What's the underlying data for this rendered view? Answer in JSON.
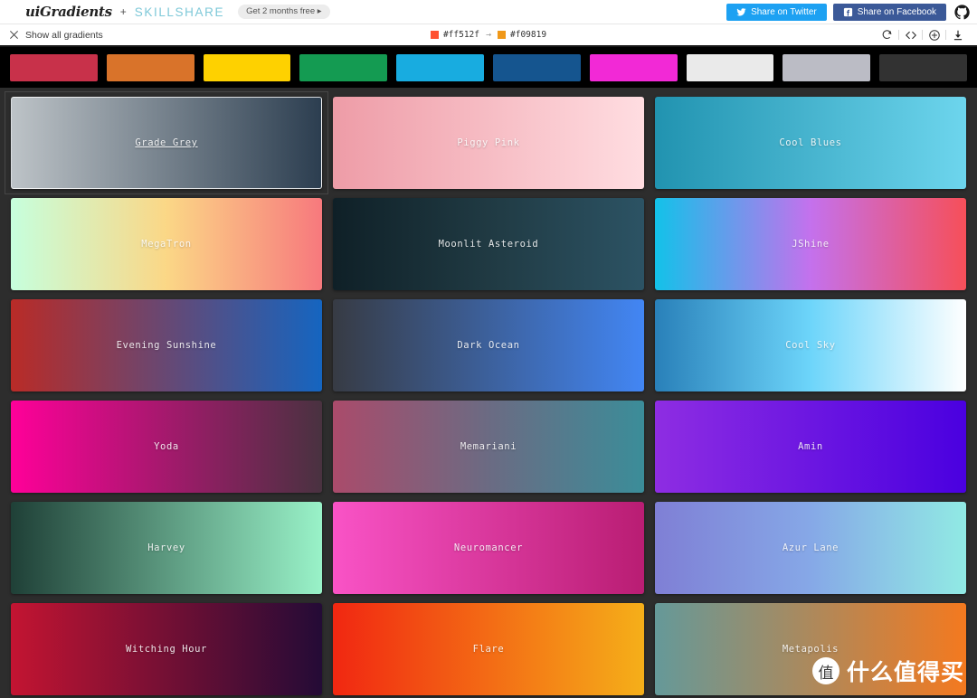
{
  "header": {
    "brand": "uiGradients",
    "plus": "+",
    "partner": "SKILLSHARE",
    "promo": "Get 2 months free ▸",
    "share_twitter": "Share on Twitter",
    "share_facebook": "Share on Facebook",
    "github_icon": "github-icon",
    "twitter_icon": "twitter-icon",
    "facebook_icon": "facebook-icon"
  },
  "subbar": {
    "show_all_label": "Show all gradients",
    "close_icon": "close-icon",
    "gradient_stops": [
      {
        "hex": "#ff512f"
      },
      {
        "hex": "#f09819"
      }
    ],
    "arrow": "→",
    "tools": [
      {
        "name": "refresh-icon",
        "title": "Random gradient"
      },
      {
        "name": "code-icon",
        "title": "Get CSS code"
      },
      {
        "name": "plus-circle-icon",
        "title": "Add gradient"
      },
      {
        "name": "download-icon",
        "title": "Download"
      }
    ]
  },
  "swatches": [
    {
      "name": "red",
      "hex": "#c8314a"
    },
    {
      "name": "orange",
      "hex": "#d9732a"
    },
    {
      "name": "yellow",
      "hex": "#fed100"
    },
    {
      "name": "green",
      "hex": "#149b52"
    },
    {
      "name": "cyan",
      "hex": "#18ace0"
    },
    {
      "name": "blue",
      "hex": "#15558f"
    },
    {
      "name": "magenta",
      "hex": "#f229d6"
    },
    {
      "name": "white",
      "hex": "#eaeaea"
    },
    {
      "name": "grey",
      "hex": "#bbbcc5"
    },
    {
      "name": "black",
      "hex": "#323232"
    }
  ],
  "gradients": [
    {
      "name": "Grade Grey",
      "from": "#bdc3c7",
      "to": "#2c3e50",
      "featured": true,
      "label_underline": true
    },
    {
      "name": "Piggy Pink",
      "from": "#ee9ca7",
      "to": "#ffdde1",
      "featured": false,
      "label_underline": false
    },
    {
      "name": "Cool Blues",
      "from": "#2193b0",
      "to": "#6dd5ed",
      "featured": false,
      "label_underline": false
    },
    {
      "name": "MegaTron",
      "from": "#c6ffdd",
      "mid": "#fbd786",
      "to": "#f7797d",
      "featured": false,
      "label_underline": false
    },
    {
      "name": "Moonlit Asteroid",
      "from": "#0f2027",
      "mid": "#203a43",
      "to": "#2c5364",
      "featured": false,
      "label_underline": false
    },
    {
      "name": "JShine",
      "from": "#12c2e9",
      "mid": "#c471ed",
      "to": "#f64f59",
      "featured": false,
      "label_underline": false
    },
    {
      "name": "Evening Sunshine",
      "from": "#b92b27",
      "to": "#1565c0",
      "featured": false,
      "label_underline": false
    },
    {
      "name": "Dark Ocean",
      "from": "#373b44",
      "to": "#4286f4",
      "featured": false,
      "label_underline": false
    },
    {
      "name": "Cool Sky",
      "from": "#2980b9",
      "mid": "#6dd5fa",
      "to": "#ffffff",
      "featured": false,
      "label_underline": false
    },
    {
      "name": "Yoda",
      "from": "#ff0099",
      "to": "#493240",
      "featured": false,
      "label_underline": false
    },
    {
      "name": "Memariani",
      "from": "#aa4b6b",
      "mid": "#6b6b83",
      "to": "#3b8d99",
      "featured": false,
      "label_underline": false
    },
    {
      "name": "Amin",
      "from": "#8e2de2",
      "to": "#4a00e0",
      "featured": false,
      "label_underline": false
    },
    {
      "name": "Harvey",
      "from": "#1f4037",
      "to": "#99f2c8",
      "featured": false,
      "label_underline": false
    },
    {
      "name": "Neuromancer",
      "from": "#f953c6",
      "to": "#b91d73",
      "featured": false,
      "label_underline": false
    },
    {
      "name": "Azur Lane",
      "from": "#7f7fd5",
      "mid": "#86a8e7",
      "to": "#91eae4",
      "featured": false,
      "label_underline": false
    },
    {
      "name": "Witching Hour",
      "from": "#c31432",
      "to": "#240b36",
      "featured": false,
      "label_underline": false
    },
    {
      "name": "Flare",
      "from": "#f12711",
      "to": "#f5af19",
      "featured": false,
      "label_underline": false
    },
    {
      "name": "Metapolis",
      "from": "#659999",
      "to": "#f4791f",
      "featured": false,
      "label_underline": false
    }
  ],
  "watermark": {
    "badge": "值",
    "text": "什么值得买"
  }
}
